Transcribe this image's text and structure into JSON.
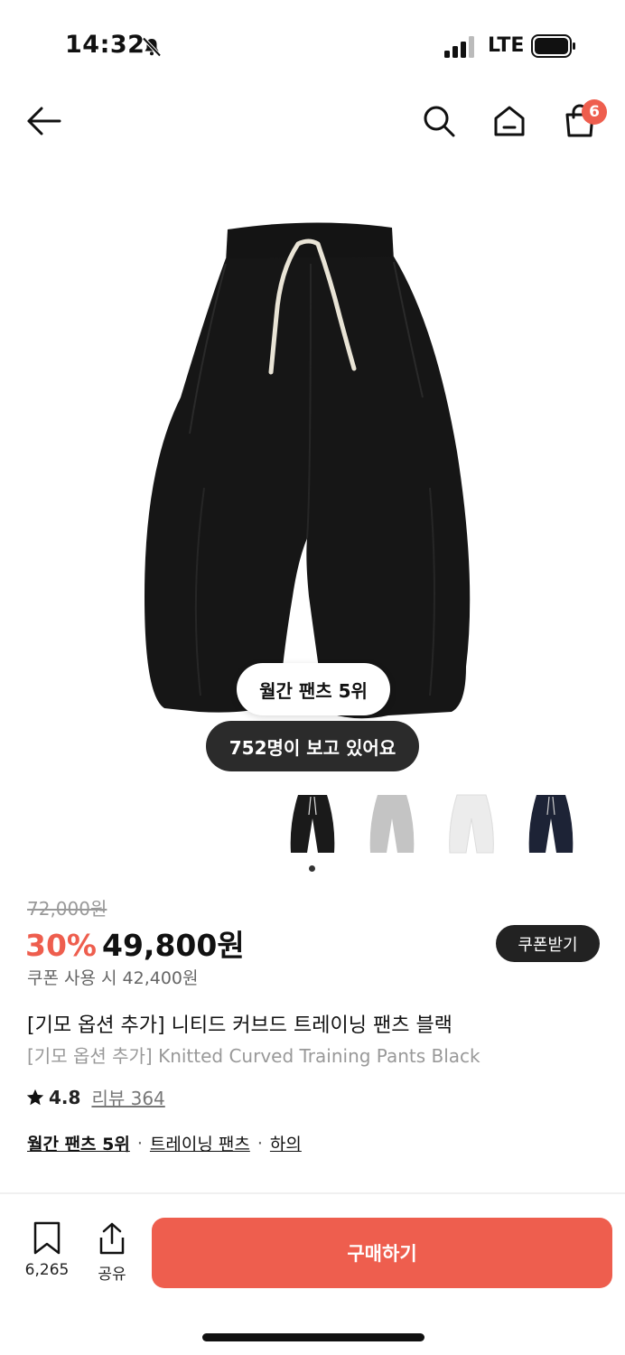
{
  "status_bar": {
    "time": "14:32",
    "network": "LTE"
  },
  "header": {
    "cart_count": "6"
  },
  "product": {
    "rank_chip": "월간 팬츠 5위",
    "viewers_chip": "752명이 보고 있어요",
    "original_price": "72,000원",
    "discount": "30%",
    "sale_price": "49,800원",
    "coupon_button": "쿠폰받기",
    "coupon_price": "쿠폰 사용 시 42,400원",
    "title_kr": "[기모 옵션 추가] 니티드 커브드 트레이닝 팬츠 블랙",
    "title_en": "[기모 옵션 추가] Knitted Curved Training Pants Black",
    "rating": "4.8",
    "review_link": "리뷰 364",
    "tags": [
      "월간 팬츠 5위",
      "트레이닝 팬츠",
      "하의"
    ],
    "color_options": [
      {
        "name": "black",
        "color": "#1a1a1a"
      },
      {
        "name": "gray",
        "color": "#c4c4c4"
      },
      {
        "name": "white",
        "color": "#ececec"
      },
      {
        "name": "navy",
        "color": "#1d2336"
      }
    ]
  },
  "bottom_bar": {
    "wishlist_count": "6,265",
    "share_label": "공유",
    "buy_label": "구매하기"
  },
  "colors": {
    "accent": "#ee5e4e",
    "dark_chip": "#2b2b2b"
  }
}
